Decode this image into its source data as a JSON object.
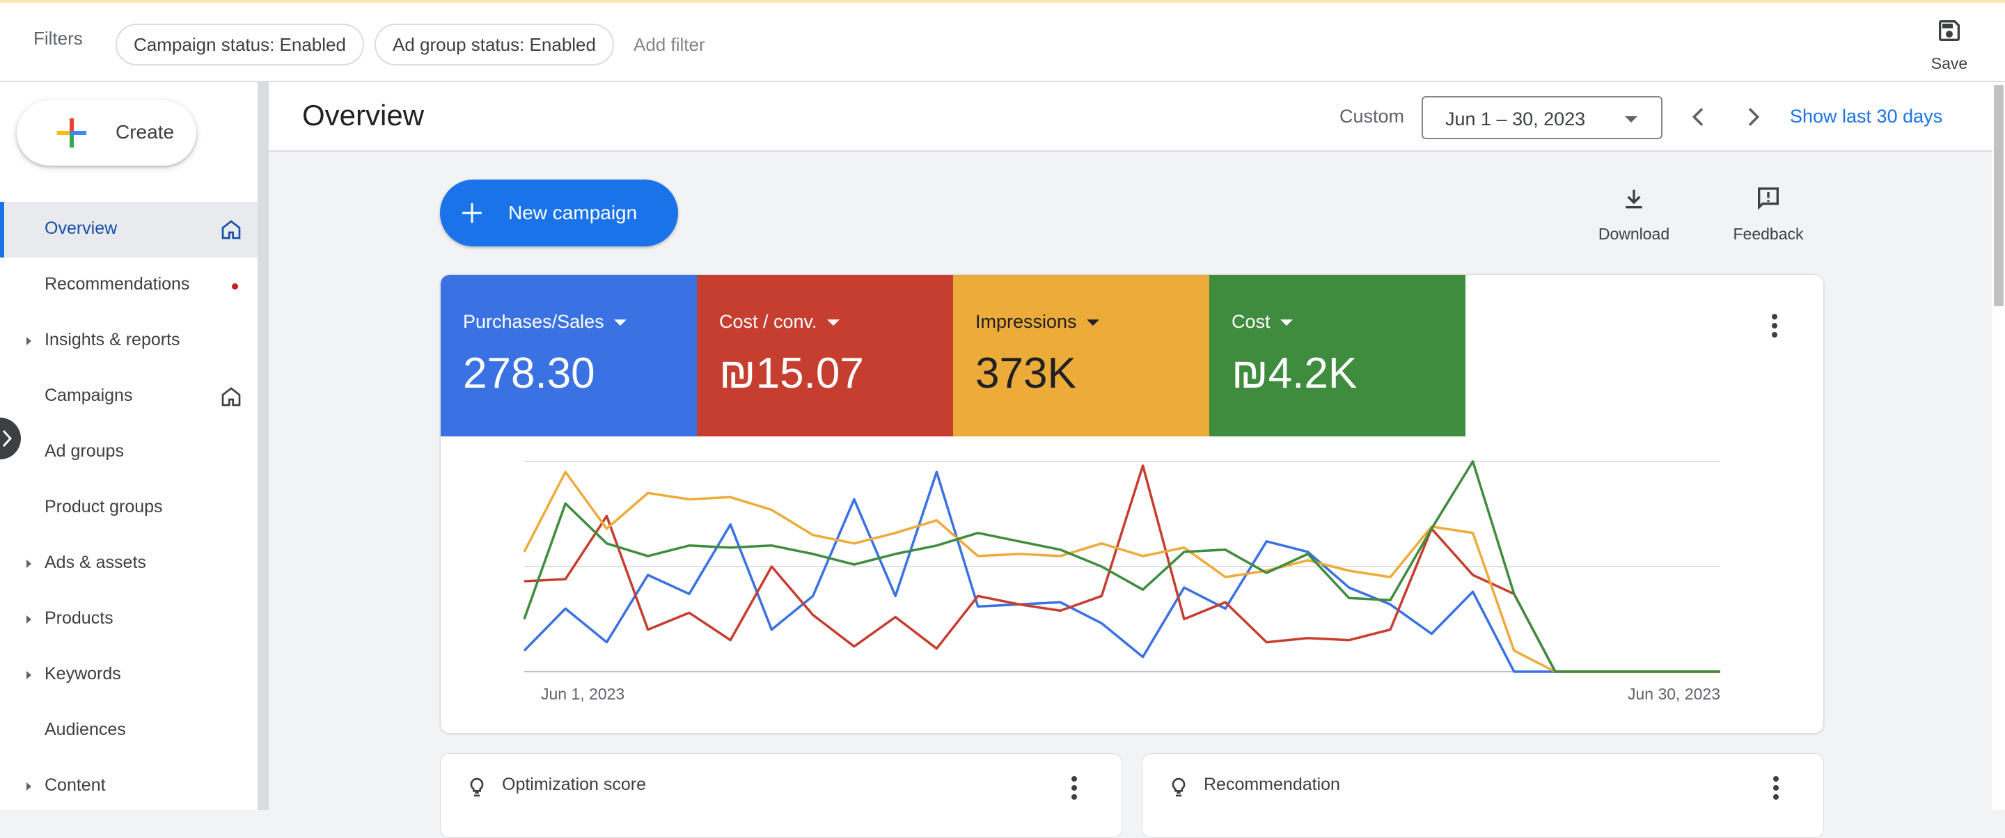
{
  "filters": {
    "label": "Filters",
    "chips": [
      "Campaign status: Enabled",
      "Ad group status: Enabled"
    ],
    "add_filter": "Add filter",
    "save_label": "Save"
  },
  "sidebar": {
    "create_label": "Create",
    "items": [
      {
        "label": "Overview",
        "active": true,
        "icon": "home-icon"
      },
      {
        "label": "Recommendations",
        "badge": "red-dot"
      },
      {
        "label": "Insights & reports",
        "expandable": true
      },
      {
        "label": "Campaigns",
        "icon": "home-icon"
      },
      {
        "label": "Ad groups"
      },
      {
        "label": "Product groups"
      },
      {
        "label": "Ads & assets",
        "expandable": true
      },
      {
        "label": "Products",
        "expandable": true
      },
      {
        "label": "Keywords",
        "expandable": true
      },
      {
        "label": "Audiences"
      },
      {
        "label": "Content",
        "expandable": true
      }
    ]
  },
  "header": {
    "title": "Overview",
    "range_type": "Custom",
    "date_range": "Jun 1 – 30, 2023",
    "show_last": "Show last 30 days"
  },
  "toolbar": {
    "new_campaign": "New campaign",
    "download": "Download",
    "feedback": "Feedback"
  },
  "metrics": [
    {
      "label": "Purchases/Sales",
      "value": "278.30",
      "color": "#3a71e3"
    },
    {
      "label": "Cost / conv.",
      "value": "₪15.07",
      "color": "#c63e2f"
    },
    {
      "label": "Impressions",
      "value": "373K",
      "color": "#edab3a"
    },
    {
      "label": "Cost",
      "value": "₪4.2K",
      "color": "#3f8c3e"
    }
  ],
  "chart_data": {
    "type": "line",
    "x_start_label": "Jun 1, 2023",
    "x_end_label": "Jun 30, 2023",
    "ylim": [
      0,
      100
    ],
    "grid": true,
    "series": [
      {
        "color": "#3a71e3",
        "values": [
          10,
          30,
          14,
          46,
          37,
          70,
          20,
          36,
          82,
          36,
          95,
          31,
          32,
          33,
          23,
          7,
          40,
          30,
          62,
          57,
          40,
          32,
          18,
          38,
          0,
          0,
          0,
          0,
          0,
          0
        ]
      },
      {
        "color": "#c63e2f",
        "values": [
          43,
          44,
          74,
          20,
          28,
          15,
          50,
          27,
          12,
          26,
          11,
          36,
          32,
          29,
          36,
          98,
          25,
          33,
          14,
          16,
          15,
          20,
          68,
          46,
          37,
          0,
          0,
          0,
          0,
          0
        ]
      },
      {
        "color": "#edab3a",
        "values": [
          57,
          95,
          68,
          85,
          82,
          83,
          77,
          65,
          61,
          66,
          72,
          55,
          56,
          55,
          61,
          55,
          59,
          45,
          48,
          53,
          48,
          45,
          69,
          66,
          10,
          0,
          0,
          0,
          0,
          0
        ]
      },
      {
        "color": "#3f8c3e",
        "values": [
          25,
          80,
          61,
          55,
          60,
          59,
          60,
          56,
          51,
          56,
          60,
          66,
          62,
          58,
          50,
          39,
          57,
          58,
          47,
          56,
          35,
          34,
          68,
          100,
          37,
          0,
          0,
          0,
          0,
          0
        ]
      }
    ]
  },
  "bottom_cards": [
    {
      "title": "Optimization score"
    },
    {
      "title": "Recommendation"
    }
  ]
}
